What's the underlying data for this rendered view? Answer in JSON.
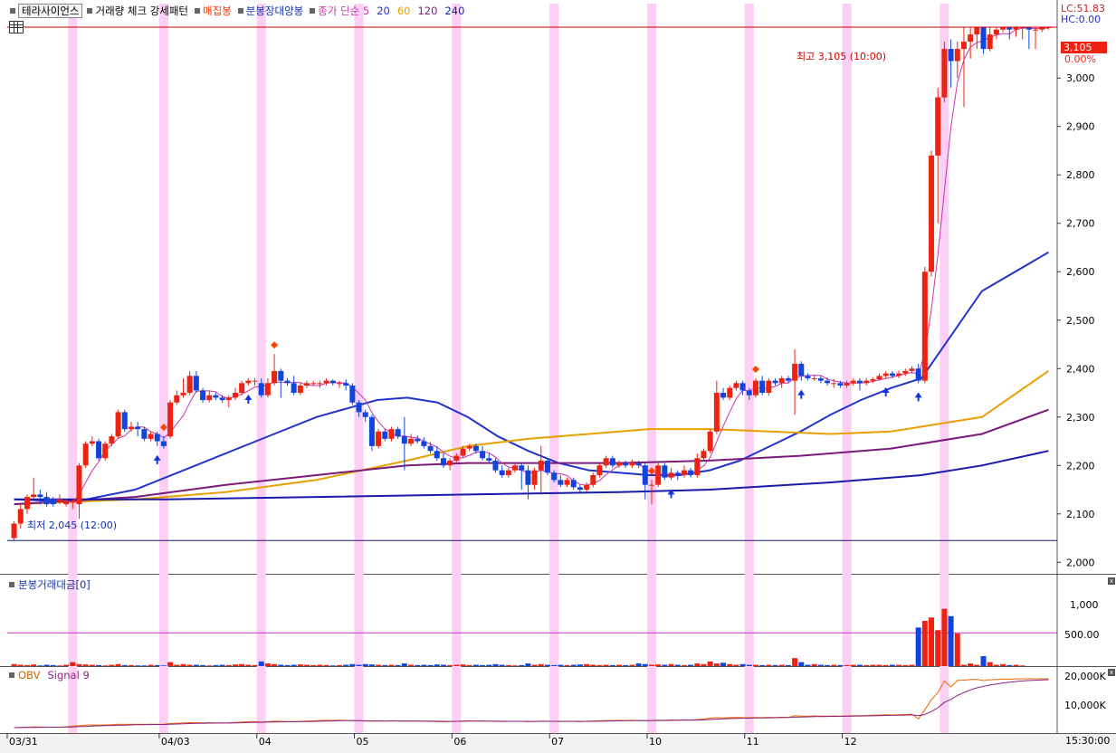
{
  "legend": {
    "name": "테라사이언스",
    "items": [
      {
        "label": "거래량 체크 강세패턴",
        "color": "#000000"
      },
      {
        "label": "매집봉",
        "color": "#ff3300"
      },
      {
        "label": "분봉장대양봉",
        "color": "#1133aa"
      }
    ],
    "ma_label": "종가 단순 5",
    "ma_periods": [
      {
        "label": "20",
        "color": "#2233cc"
      },
      {
        "label": "60",
        "color": "#e8a000"
      },
      {
        "label": "120",
        "color": "#7a1a7a"
      },
      {
        "label": "240",
        "color": "#1a1aaa"
      }
    ]
  },
  "top_right": {
    "lc": "LC:51.83",
    "hc": "HC:0.00"
  },
  "price_tag": {
    "value": "3,105",
    "pct": "0.00%"
  },
  "annotations": {
    "high": "최고 3,105 (10:00)",
    "low": "최저 2,045 (12:00)"
  },
  "volume_panel": {
    "title": "분봉거래대금[0]",
    "ticks": [
      "1,000",
      "500.00"
    ]
  },
  "obv_panel": {
    "title_a": "OBV",
    "title_b": "Signal 9",
    "ticks": [
      "20,000K",
      "10,000K"
    ]
  },
  "time_label": "15:30:00",
  "colors": {
    "up": "#ee2211",
    "down": "#1144dd",
    "highlight": "#fbd0f4",
    "ma5": "#cc33aa"
  },
  "chart_data": {
    "type": "candlestick",
    "ylim": [
      1980,
      3120
    ],
    "yticks": [
      "2,000",
      "2,100",
      "2,200",
      "2,300",
      "2,400",
      "2,500",
      "2,600",
      "2,700",
      "2,800",
      "2,900",
      "3,000"
    ],
    "x_dates": [
      "03/31",
      "04/03",
      "04",
      "05",
      "06",
      "07",
      "10",
      "11",
      "12"
    ],
    "high_line": 3105,
    "low_line": 2045,
    "candles": [
      [
        2050,
        2080,
        2045,
        2085
      ],
      [
        2080,
        2110,
        2070,
        2120
      ],
      [
        2110,
        2135,
        2100,
        2140
      ],
      [
        2135,
        2140,
        2130,
        2175
      ],
      [
        2140,
        2135,
        2120,
        2150
      ],
      [
        2135,
        2120,
        2115,
        2145
      ],
      [
        2130,
        2120,
        2115,
        2135
      ],
      [
        2125,
        2130,
        2120,
        2140
      ],
      [
        2120,
        2125,
        2115,
        2130
      ],
      [
        2125,
        2125,
        2110,
        2130
      ],
      [
        2120,
        2200,
        2090,
        2205
      ],
      [
        2200,
        2245,
        2195,
        2250
      ],
      [
        2245,
        2250,
        2240,
        2260
      ],
      [
        2250,
        2215,
        2210,
        2255
      ],
      [
        2215,
        2245,
        2210,
        2250
      ],
      [
        2245,
        2260,
        2240,
        2265
      ],
      [
        2260,
        2310,
        2255,
        2315
      ],
      [
        2310,
        2275,
        2270,
        2315
      ],
      [
        2275,
        2280,
        2270,
        2290
      ],
      [
        2280,
        2275,
        2260,
        2290
      ],
      [
        2275,
        2255,
        2250,
        2280
      ],
      [
        2255,
        2265,
        2250,
        2270
      ],
      [
        2265,
        2250,
        2240,
        2270
      ],
      [
        2250,
        2240,
        2235,
        2260
      ],
      [
        2260,
        2330,
        2255,
        2335
      ],
      [
        2330,
        2345,
        2325,
        2355
      ],
      [
        2345,
        2350,
        2340,
        2380
      ],
      [
        2350,
        2385,
        2345,
        2395
      ],
      [
        2385,
        2355,
        2350,
        2395
      ],
      [
        2355,
        2335,
        2330,
        2360
      ],
      [
        2335,
        2345,
        2330,
        2355
      ],
      [
        2345,
        2340,
        2335,
        2350
      ],
      [
        2340,
        2335,
        2330,
        2345
      ],
      [
        2335,
        2340,
        2320,
        2345
      ],
      [
        2340,
        2350,
        2335,
        2360
      ],
      [
        2350,
        2370,
        2345,
        2375
      ],
      [
        2370,
        2375,
        2365,
        2380
      ],
      [
        2375,
        2375,
        2365,
        2380
      ],
      [
        2370,
        2345,
        2340,
        2380
      ],
      [
        2345,
        2370,
        2340,
        2380
      ],
      [
        2370,
        2395,
        2365,
        2430
      ],
      [
        2395,
        2375,
        2340,
        2400
      ],
      [
        2375,
        2370,
        2365,
        2380
      ],
      [
        2370,
        2350,
        2345,
        2385
      ],
      [
        2350,
        2365,
        2345,
        2370
      ],
      [
        2365,
        2370,
        2360,
        2375
      ],
      [
        2370,
        2370,
        2365,
        2375
      ],
      [
        2370,
        2370,
        2360,
        2375
      ],
      [
        2370,
        2375,
        2365,
        2380
      ],
      [
        2375,
        2370,
        2365,
        2378
      ],
      [
        2370,
        2370,
        2360,
        2375
      ],
      [
        2370,
        2365,
        2355,
        2378
      ],
      [
        2365,
        2330,
        2325,
        2370
      ],
      [
        2330,
        2310,
        2300,
        2335
      ],
      [
        2310,
        2300,
        2290,
        2315
      ],
      [
        2300,
        2240,
        2230,
        2305
      ],
      [
        2240,
        2270,
        2235,
        2275
      ],
      [
        2270,
        2255,
        2250,
        2275
      ],
      [
        2255,
        2275,
        2250,
        2280
      ],
      [
        2275,
        2260,
        2255,
        2280
      ],
      [
        2260,
        2245,
        2190,
        2300
      ],
      [
        2245,
        2255,
        2240,
        2265
      ],
      [
        2255,
        2250,
        2245,
        2262
      ],
      [
        2250,
        2240,
        2235,
        2258
      ],
      [
        2240,
        2230,
        2225,
        2248
      ],
      [
        2230,
        2215,
        2210,
        2240
      ],
      [
        2215,
        2200,
        2195,
        2225
      ],
      [
        2200,
        2210,
        2190,
        2215
      ],
      [
        2210,
        2220,
        2205,
        2225
      ],
      [
        2220,
        2235,
        2215,
        2240
      ],
      [
        2235,
        2240,
        2230,
        2245
      ],
      [
        2240,
        2230,
        2225,
        2245
      ],
      [
        2230,
        2215,
        2210,
        2240
      ],
      [
        2215,
        2210,
        2205,
        2225
      ],
      [
        2210,
        2190,
        2185,
        2215
      ],
      [
        2190,
        2180,
        2175,
        2200
      ],
      [
        2180,
        2190,
        2175,
        2195
      ],
      [
        2190,
        2200,
        2185,
        2205
      ],
      [
        2200,
        2190,
        2150,
        2205
      ],
      [
        2190,
        2160,
        2130,
        2200
      ],
      [
        2160,
        2190,
        2150,
        2195
      ],
      [
        2190,
        2210,
        2140,
        2240
      ],
      [
        2210,
        2185,
        2180,
        2215
      ],
      [
        2185,
        2170,
        2165,
        2190
      ],
      [
        2170,
        2160,
        2155,
        2180
      ],
      [
        2160,
        2170,
        2155,
        2175
      ],
      [
        2170,
        2155,
        2150,
        2175
      ],
      [
        2155,
        2150,
        2145,
        2160
      ],
      [
        2150,
        2160,
        2145,
        2165
      ],
      [
        2160,
        2180,
        2155,
        2185
      ],
      [
        2180,
        2200,
        2175,
        2205
      ],
      [
        2200,
        2215,
        2195,
        2220
      ],
      [
        2215,
        2200,
        2195,
        2220
      ],
      [
        2200,
        2205,
        2195,
        2210
      ],
      [
        2205,
        2200,
        2195,
        2210
      ],
      [
        2200,
        2205,
        2195,
        2212
      ],
      [
        2205,
        2200,
        2195,
        2210
      ],
      [
        2200,
        2160,
        2130,
        2205
      ],
      [
        2160,
        2160,
        2120,
        2170
      ],
      [
        2160,
        2200,
        2155,
        2205
      ],
      [
        2200,
        2175,
        2170,
        2205
      ],
      [
        2175,
        2185,
        2170,
        2195
      ],
      [
        2185,
        2180,
        2170,
        2190
      ],
      [
        2180,
        2190,
        2175,
        2200
      ],
      [
        2190,
        2180,
        2175,
        2195
      ],
      [
        2180,
        2215,
        2175,
        2225
      ],
      [
        2215,
        2230,
        2210,
        2235
      ],
      [
        2230,
        2270,
        2225,
        2275
      ],
      [
        2270,
        2350,
        2265,
        2375
      ],
      [
        2350,
        2340,
        2335,
        2360
      ],
      [
        2340,
        2360,
        2335,
        2365
      ],
      [
        2360,
        2370,
        2355,
        2375
      ],
      [
        2370,
        2355,
        2345,
        2375
      ],
      [
        2355,
        2345,
        2335,
        2360
      ],
      [
        2345,
        2375,
        2340,
        2380
      ],
      [
        2375,
        2350,
        2345,
        2385
      ],
      [
        2350,
        2375,
        2345,
        2380
      ],
      [
        2375,
        2370,
        2365,
        2380
      ],
      [
        2370,
        2380,
        2360,
        2385
      ],
      [
        2380,
        2375,
        2370,
        2385
      ],
      [
        2375,
        2410,
        2305,
        2440
      ],
      [
        2410,
        2385,
        2375,
        2415
      ],
      [
        2385,
        2380,
        2375,
        2390
      ],
      [
        2380,
        2380,
        2375,
        2387
      ],
      [
        2380,
        2375,
        2370,
        2385
      ],
      [
        2375,
        2370,
        2365,
        2382
      ],
      [
        2370,
        2370,
        2360,
        2378
      ],
      [
        2370,
        2365,
        2360,
        2375
      ],
      [
        2365,
        2370,
        2360,
        2375
      ],
      [
        2370,
        2375,
        2365,
        2380
      ],
      [
        2375,
        2370,
        2355,
        2380
      ],
      [
        2370,
        2375,
        2365,
        2380
      ],
      [
        2375,
        2378,
        2370,
        2382
      ],
      [
        2378,
        2385,
        2375,
        2390
      ],
      [
        2385,
        2390,
        2380,
        2395
      ],
      [
        2390,
        2385,
        2380,
        2395
      ],
      [
        2385,
        2390,
        2380,
        2396
      ],
      [
        2390,
        2395,
        2385,
        2400
      ],
      [
        2395,
        2400,
        2390,
        2405
      ],
      [
        2400,
        2375,
        2370,
        2410
      ],
      [
        2375,
        2600,
        2370,
        2610
      ],
      [
        2600,
        2840,
        2590,
        2850
      ],
      [
        2840,
        2960,
        2700,
        2980
      ],
      [
        2960,
        3060,
        2950,
        3075
      ],
      [
        3060,
        3035,
        2980,
        3080
      ],
      [
        3035,
        3060,
        3000,
        3075
      ],
      [
        3060,
        3075,
        2940,
        3105
      ],
      [
        3075,
        3090,
        3040,
        3105
      ],
      [
        3090,
        3105,
        3060,
        3105
      ],
      [
        3105,
        3060,
        3050,
        3105
      ],
      [
        3060,
        3090,
        3055,
        3105
      ],
      [
        3090,
        3100,
        3080,
        3105
      ],
      [
        3100,
        3105,
        3095,
        3105
      ],
      [
        3105,
        3100,
        3080,
        3105
      ],
      [
        3100,
        3105,
        3085,
        3105
      ],
      [
        3105,
        3105,
        3080,
        3105
      ],
      [
        3105,
        3100,
        3060,
        3105
      ],
      [
        3100,
        3100,
        3060,
        3105
      ],
      [
        3100,
        3105,
        3095,
        3105
      ],
      [
        3105,
        3105,
        3100,
        3105
      ]
    ],
    "ma_lines": [
      {
        "name": "20",
        "color": "#2233cc",
        "points": [
          [
            0,
            2130
          ],
          [
            40,
            2125
          ],
          [
            80,
            2150
          ],
          [
            120,
            2200
          ],
          [
            160,
            2250
          ],
          [
            200,
            2300
          ],
          [
            240,
            2335
          ],
          [
            260,
            2340
          ],
          [
            280,
            2330
          ],
          [
            300,
            2300
          ],
          [
            320,
            2260
          ],
          [
            340,
            2230
          ],
          [
            360,
            2205
          ],
          [
            380,
            2190
          ],
          [
            400,
            2185
          ],
          [
            420,
            2180
          ],
          [
            440,
            2180
          ],
          [
            460,
            2190
          ],
          [
            480,
            2210
          ],
          [
            500,
            2240
          ],
          [
            520,
            2270
          ],
          [
            540,
            2305
          ],
          [
            560,
            2335
          ],
          [
            580,
            2360
          ],
          [
            600,
            2380
          ],
          [
            640,
            2560
          ],
          [
            684,
            2640
          ]
        ]
      },
      {
        "name": "60",
        "color": "#e8a000",
        "points": [
          [
            0,
            2120
          ],
          [
            80,
            2130
          ],
          [
            140,
            2145
          ],
          [
            200,
            2170
          ],
          [
            260,
            2210
          ],
          [
            300,
            2240
          ],
          [
            340,
            2255
          ],
          [
            380,
            2265
          ],
          [
            420,
            2275
          ],
          [
            460,
            2275
          ],
          [
            500,
            2270
          ],
          [
            540,
            2265
          ],
          [
            580,
            2270
          ],
          [
            640,
            2300
          ],
          [
            684,
            2395
          ]
        ]
      },
      {
        "name": "120",
        "color": "#7a1a7a",
        "points": [
          [
            0,
            2120
          ],
          [
            80,
            2135
          ],
          [
            140,
            2160
          ],
          [
            200,
            2180
          ],
          [
            260,
            2200
          ],
          [
            300,
            2205
          ],
          [
            340,
            2205
          ],
          [
            400,
            2205
          ],
          [
            460,
            2210
          ],
          [
            520,
            2220
          ],
          [
            580,
            2235
          ],
          [
            640,
            2265
          ],
          [
            684,
            2315
          ]
        ]
      },
      {
        "name": "240",
        "color": "#1a1aaa",
        "points": [
          [
            0,
            2130
          ],
          [
            100,
            2130
          ],
          [
            200,
            2135
          ],
          [
            300,
            2140
          ],
          [
            400,
            2145
          ],
          [
            460,
            2150
          ],
          [
            540,
            2165
          ],
          [
            600,
            2180
          ],
          [
            640,
            2200
          ],
          [
            684,
            2230
          ]
        ]
      }
    ],
    "volume": [
      30,
      20,
      15,
      25,
      10,
      20,
      15,
      10,
      20,
      60,
      30,
      25,
      20,
      15,
      10,
      20,
      30,
      15,
      15,
      10,
      10,
      20,
      15,
      10,
      60,
      20,
      30,
      20,
      20,
      15,
      10,
      15,
      20,
      15,
      25,
      30,
      20,
      15,
      70,
      40,
      30,
      20,
      15,
      20,
      25,
      20,
      15,
      20,
      15,
      10,
      15,
      20,
      30,
      20,
      30,
      25,
      20,
      15,
      20,
      15,
      40,
      20,
      15,
      20,
      15,
      25,
      20,
      15,
      20,
      25,
      15,
      20,
      15,
      20,
      30,
      20,
      15,
      10,
      15,
      40,
      20,
      30,
      20,
      15,
      20,
      15,
      20,
      25,
      30,
      20,
      15,
      20,
      15,
      20,
      15,
      20,
      40,
      30,
      20,
      25,
      20,
      30,
      20,
      15,
      20,
      40,
      30,
      70,
      40,
      50,
      30,
      20,
      30,
      20,
      20,
      15,
      20,
      15,
      20,
      15,
      120,
      60,
      20,
      30,
      20,
      15,
      20,
      15,
      15,
      20,
      20,
      15,
      20,
      20,
      15,
      20,
      20,
      15,
      20,
      580,
      680,
      730,
      540,
      860,
      750,
      490,
      20,
      40,
      20,
      150,
      60,
      20,
      30,
      15,
      20,
      10
    ],
    "highlight_cols": [
      9,
      23,
      38,
      53,
      68,
      83,
      98,
      113,
      128,
      143
    ]
  }
}
